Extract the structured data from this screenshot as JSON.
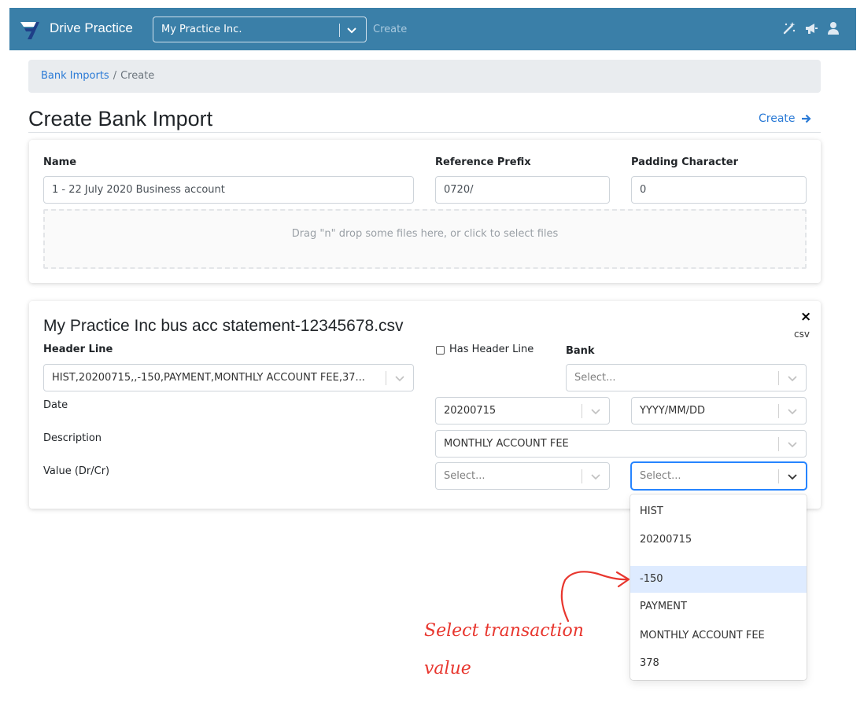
{
  "nav": {
    "brand": "Drive Practice",
    "company": "My Practice Inc.",
    "create": "Create",
    "icons": [
      "magic-wand-icon",
      "megaphone-icon",
      "user-icon"
    ],
    "bg_color": "#3a7fa8"
  },
  "breadcrumb": {
    "link": "Bank Imports",
    "separator": "/",
    "current": "Create"
  },
  "page": {
    "title": "Create Bank Import",
    "create_link": "Create"
  },
  "import_form": {
    "name_label": "Name",
    "name_value": "1 - 22 July 2020 Business account",
    "prefix_label": "Reference Prefix",
    "prefix_value": "0720/",
    "padding_label": "Padding Character",
    "padding_value": "0",
    "dropzone_text": "Drag \"n\" drop some files here, or click to select files"
  },
  "file_card": {
    "title": "My Practice Inc bus acc statement-12345678.csv",
    "close": "×",
    "type_tag": "csv",
    "header_line_label": "Header Line",
    "header_line_value": "HIST,20200715,,-150,PAYMENT,MONTHLY ACCOUNT FEE,37...",
    "has_header_label": "Has Header Line",
    "has_header_checked": false,
    "bank_label": "Bank",
    "bank_placeholder": "Select...",
    "date_label": "Date",
    "date_column": "20200715",
    "date_format": "YYYY/MM/DD",
    "description_label": "Description",
    "description_column": "MONTHLY ACCOUNT FEE",
    "value_label": "Value (Dr/Cr)",
    "value_dr_placeholder": "Select...",
    "value_cr_placeholder": "Select..."
  },
  "value_menu": {
    "options": [
      "HIST",
      "20200715",
      "",
      "-150",
      "PAYMENT",
      "MONTHLY ACCOUNT FEE",
      "378"
    ],
    "highlighted_index": 3
  },
  "annotation": {
    "line1": "Select transaction",
    "line2": "value",
    "color": "#e8362e"
  }
}
